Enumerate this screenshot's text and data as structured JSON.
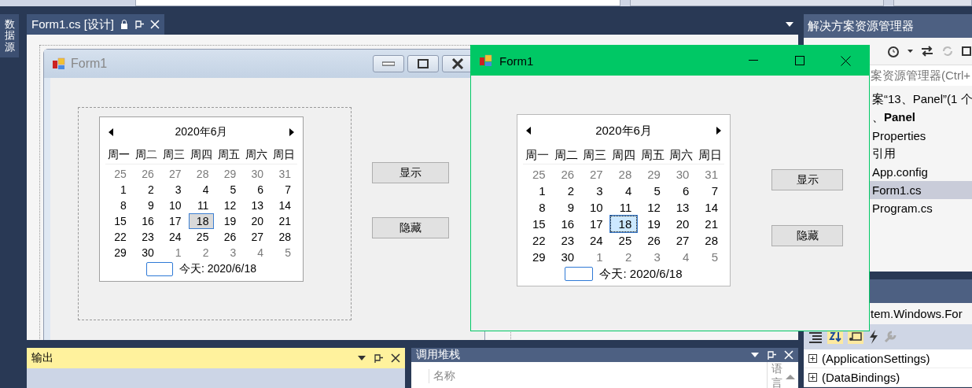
{
  "left_sidebar": {
    "tab": "数据源"
  },
  "document_tab": {
    "title": "Form1.cs [设计]",
    "selected": true
  },
  "designer": {
    "form": {
      "title": "Form1",
      "calendar": {
        "month_title": "2020年6月",
        "focused": false,
        "weekdays": [
          "周一",
          "周二",
          "周三",
          "周四",
          "周五",
          "周六",
          "周日"
        ],
        "weeks": [
          [
            {
              "d": "25",
              "muted": true,
              "selected": false
            },
            {
              "d": "26",
              "muted": true,
              "selected": false
            },
            {
              "d": "27",
              "muted": true,
              "selected": false
            },
            {
              "d": "28",
              "muted": true,
              "selected": false
            },
            {
              "d": "29",
              "muted": true,
              "selected": false
            },
            {
              "d": "30",
              "muted": true,
              "selected": false
            },
            {
              "d": "31",
              "muted": true,
              "selected": false
            }
          ],
          [
            {
              "d": "1",
              "muted": false,
              "selected": false
            },
            {
              "d": "2",
              "muted": false,
              "selected": false
            },
            {
              "d": "3",
              "muted": false,
              "selected": false
            },
            {
              "d": "4",
              "muted": false,
              "selected": false
            },
            {
              "d": "5",
              "muted": false,
              "selected": false
            },
            {
              "d": "6",
              "muted": false,
              "selected": false
            },
            {
              "d": "7",
              "muted": false,
              "selected": false
            }
          ],
          [
            {
              "d": "8",
              "muted": false,
              "selected": false
            },
            {
              "d": "9",
              "muted": false,
              "selected": false
            },
            {
              "d": "10",
              "muted": false,
              "selected": false
            },
            {
              "d": "11",
              "muted": false,
              "selected": false
            },
            {
              "d": "12",
              "muted": false,
              "selected": false
            },
            {
              "d": "13",
              "muted": false,
              "selected": false
            },
            {
              "d": "14",
              "muted": false,
              "selected": false
            }
          ],
          [
            {
              "d": "15",
              "muted": false,
              "selected": false
            },
            {
              "d": "16",
              "muted": false,
              "selected": false
            },
            {
              "d": "17",
              "muted": false,
              "selected": false
            },
            {
              "d": "18",
              "muted": false,
              "selected": true
            },
            {
              "d": "19",
              "muted": false,
              "selected": false
            },
            {
              "d": "20",
              "muted": false,
              "selected": false
            },
            {
              "d": "21",
              "muted": false,
              "selected": false
            }
          ],
          [
            {
              "d": "22",
              "muted": false,
              "selected": false
            },
            {
              "d": "23",
              "muted": false,
              "selected": false
            },
            {
              "d": "24",
              "muted": false,
              "selected": false
            },
            {
              "d": "25",
              "muted": false,
              "selected": false
            },
            {
              "d": "26",
              "muted": false,
              "selected": false
            },
            {
              "d": "27",
              "muted": false,
              "selected": false
            },
            {
              "d": "28",
              "muted": false,
              "selected": false
            }
          ],
          [
            {
              "d": "29",
              "muted": false,
              "selected": false
            },
            {
              "d": "30",
              "muted": false,
              "selected": false
            },
            {
              "d": "1",
              "muted": true,
              "selected": false
            },
            {
              "d": "2",
              "muted": true,
              "selected": false
            },
            {
              "d": "3",
              "muted": true,
              "selected": false
            },
            {
              "d": "4",
              "muted": true,
              "selected": false
            },
            {
              "d": "5",
              "muted": true,
              "selected": false
            }
          ]
        ],
        "today_label": "今天: 2020/6/18"
      },
      "buttons": [
        "显示",
        "隐藏"
      ]
    }
  },
  "running_window": {
    "title": "Form1",
    "calendar": {
      "month_title": "2020年6月",
      "focused": true,
      "weekdays": [
        "周一",
        "周二",
        "周三",
        "周四",
        "周五",
        "周六",
        "周日"
      ],
      "weeks": [
        [
          {
            "d": "25",
            "muted": true,
            "selected": false
          },
          {
            "d": "26",
            "muted": true,
            "selected": false
          },
          {
            "d": "27",
            "muted": true,
            "selected": false
          },
          {
            "d": "28",
            "muted": true,
            "selected": false
          },
          {
            "d": "29",
            "muted": true,
            "selected": false
          },
          {
            "d": "30",
            "muted": true,
            "selected": false
          },
          {
            "d": "31",
            "muted": true,
            "selected": false
          }
        ],
        [
          {
            "d": "1",
            "muted": false,
            "selected": false
          },
          {
            "d": "2",
            "muted": false,
            "selected": false
          },
          {
            "d": "3",
            "muted": false,
            "selected": false
          },
          {
            "d": "4",
            "muted": false,
            "selected": false
          },
          {
            "d": "5",
            "muted": false,
            "selected": false
          },
          {
            "d": "6",
            "muted": false,
            "selected": false
          },
          {
            "d": "7",
            "muted": false,
            "selected": false
          }
        ],
        [
          {
            "d": "8",
            "muted": false,
            "selected": false
          },
          {
            "d": "9",
            "muted": false,
            "selected": false
          },
          {
            "d": "10",
            "muted": false,
            "selected": false
          },
          {
            "d": "11",
            "muted": false,
            "selected": false
          },
          {
            "d": "12",
            "muted": false,
            "selected": false
          },
          {
            "d": "13",
            "muted": false,
            "selected": false
          },
          {
            "d": "14",
            "muted": false,
            "selected": false
          }
        ],
        [
          {
            "d": "15",
            "muted": false,
            "selected": false
          },
          {
            "d": "16",
            "muted": false,
            "selected": false
          },
          {
            "d": "17",
            "muted": false,
            "selected": false
          },
          {
            "d": "18",
            "muted": false,
            "selected": true
          },
          {
            "d": "19",
            "muted": false,
            "selected": false
          },
          {
            "d": "20",
            "muted": false,
            "selected": false
          },
          {
            "d": "21",
            "muted": false,
            "selected": false
          }
        ],
        [
          {
            "d": "22",
            "muted": false,
            "selected": false
          },
          {
            "d": "23",
            "muted": false,
            "selected": false
          },
          {
            "d": "24",
            "muted": false,
            "selected": false
          },
          {
            "d": "25",
            "muted": false,
            "selected": false
          },
          {
            "d": "26",
            "muted": false,
            "selected": false
          },
          {
            "d": "27",
            "muted": false,
            "selected": false
          },
          {
            "d": "28",
            "muted": false,
            "selected": false
          }
        ],
        [
          {
            "d": "29",
            "muted": false,
            "selected": false
          },
          {
            "d": "30",
            "muted": false,
            "selected": false
          },
          {
            "d": "1",
            "muted": true,
            "selected": false
          },
          {
            "d": "2",
            "muted": true,
            "selected": false
          },
          {
            "d": "3",
            "muted": true,
            "selected": false
          },
          {
            "d": "4",
            "muted": true,
            "selected": false
          },
          {
            "d": "5",
            "muted": true,
            "selected": false
          }
        ]
      ],
      "today_label": "今天: 2020/6/18"
    },
    "buttons": [
      "显示",
      "隐藏"
    ]
  },
  "solution_explorer": {
    "title": "解决方案资源管理器",
    "placeholder": "案资源管理器(Ctrl+",
    "tree": [
      {
        "label": "案“13、Panel”(1 个",
        "selected": false,
        "children": [
          {
            "label": "、**Panel**",
            "selected": false,
            "children": [
              {
                "label": "Properties",
                "selected": false
              },
              {
                "label": "引用",
                "selected": false
              },
              {
                "label": "App.config",
                "selected": false
              },
              {
                "label": "Form1.cs",
                "selected": true
              },
              {
                "label": "Program.cs",
                "selected": false
              }
            ]
          }
        ]
      }
    ]
  },
  "properties": {
    "object": "tem.Windows.For",
    "rows": [
      {
        "label": "(ApplicationSettings)",
        "expanded": false
      },
      {
        "label": "(DataBindings)",
        "expanded": false
      }
    ]
  },
  "output_panel": {
    "title": "输出"
  },
  "call_stack": {
    "title": "调用堆栈",
    "columns": [
      "名称",
      "语言"
    ]
  }
}
